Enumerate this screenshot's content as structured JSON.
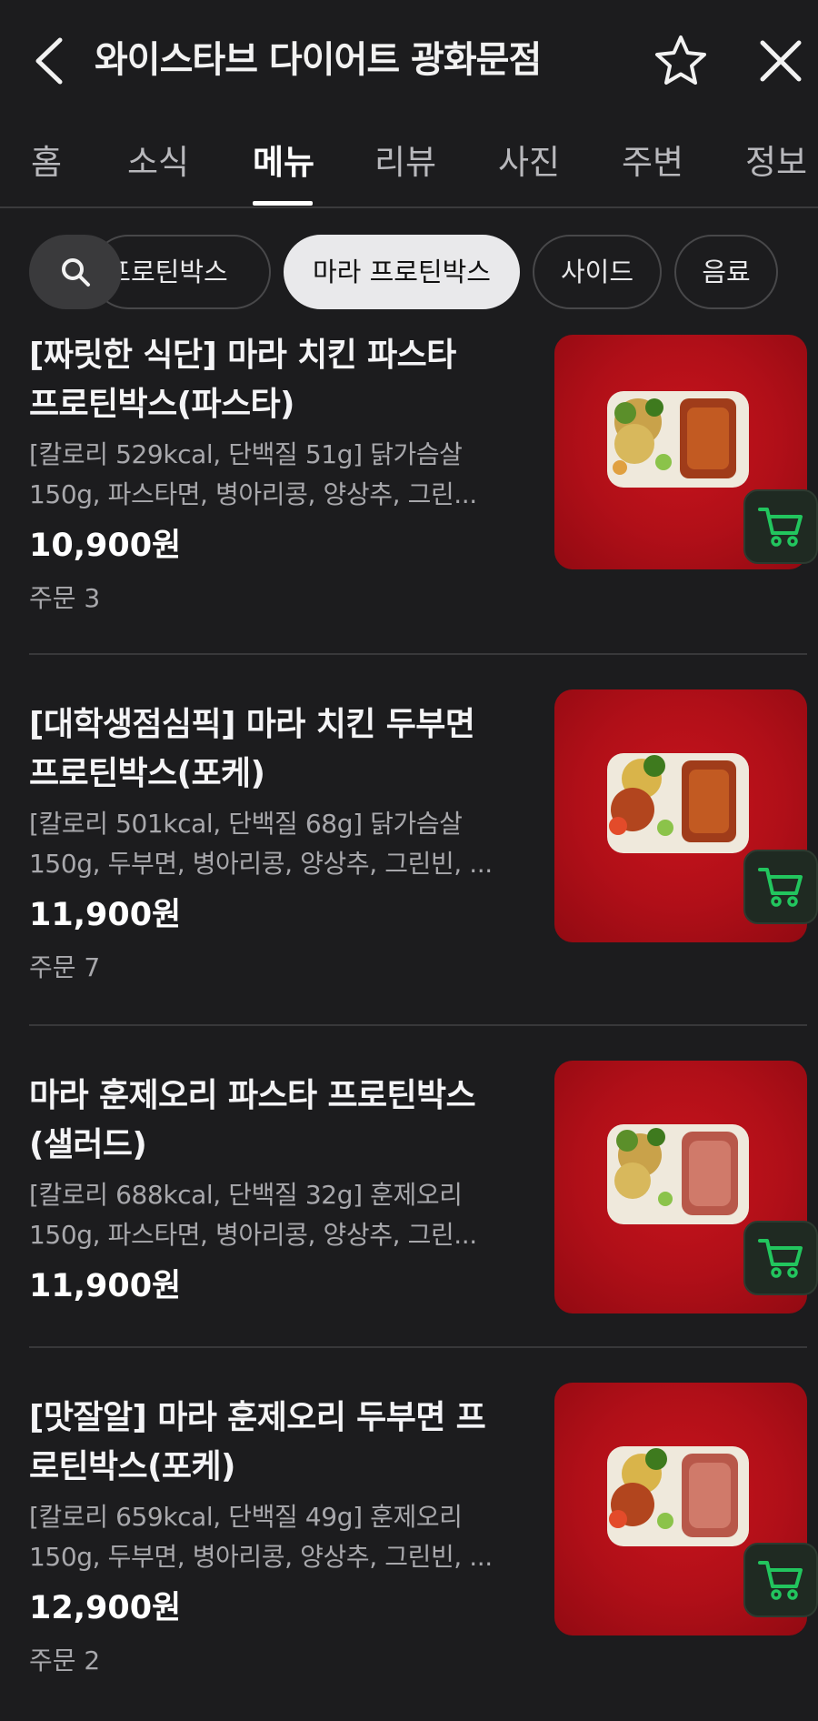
{
  "header": {
    "title": "와이스타브 다이어트 광화문점",
    "back_icon": "chevron-left-icon",
    "favorite_icon": "star-outline-icon",
    "close_icon": "close-icon"
  },
  "tabs": [
    {
      "label": "홈"
    },
    {
      "label": "소식"
    },
    {
      "label": "메뉴",
      "active": true
    },
    {
      "label": "리뷰"
    },
    {
      "label": "사진"
    },
    {
      "label": "주변"
    },
    {
      "label": "정보"
    }
  ],
  "categories": {
    "search_icon": "search-icon",
    "chips": [
      {
        "label": "프로틴박스"
      },
      {
        "label": "마라 프로틴박스",
        "active": true
      },
      {
        "label": "사이드"
      },
      {
        "label": "음료"
      }
    ]
  },
  "menu_items": [
    {
      "name_line1": "[짜릿한 식단] 마라 치킨 파스타",
      "name_line2": "프로틴박스(파스타)",
      "desc_line1": "[칼로리 529kcal, 단백질 51g] 닭가슴살",
      "desc_line2": "150g, 파스타면, 병아리콩, 양상추, 그린...",
      "price": "10,900원",
      "orders": "주문 3"
    },
    {
      "name_line1": "[대학생점심픽] 마라 치킨 두부면",
      "name_line2": "프로틴박스(포케)",
      "desc_line1": "[칼로리 501kcal, 단백질 68g] 닭가슴살",
      "desc_line2": "150g, 두부면, 병아리콩, 양상추, 그린빈, ...",
      "price": "11,900원",
      "orders": "주문 7"
    },
    {
      "name_line1": "마라 훈제오리 파스타 프로틴박스",
      "name_line2": "(샐러드)",
      "desc_line1": "[칼로리 688kcal, 단백질 32g] 훈제오리",
      "desc_line2": "150g, 파스타면, 병아리콩, 양상추, 그린...",
      "price": "11,900원",
      "orders": ""
    },
    {
      "name_line1": "[맛잘알] 마라 훈제오리 두부면 프",
      "name_line2": "로틴박스(포케)",
      "desc_line1": "[칼로리 659kcal, 단백질 49g] 훈제오리",
      "desc_line2": "150g, 두부면, 병아리콩, 양상추, 그린빈, ...",
      "price": "12,900원",
      "orders": "주문 2"
    }
  ],
  "colors": {
    "background": "#1c1c1e",
    "image_red": "#c8141c",
    "cart_green": "#22c55e"
  }
}
